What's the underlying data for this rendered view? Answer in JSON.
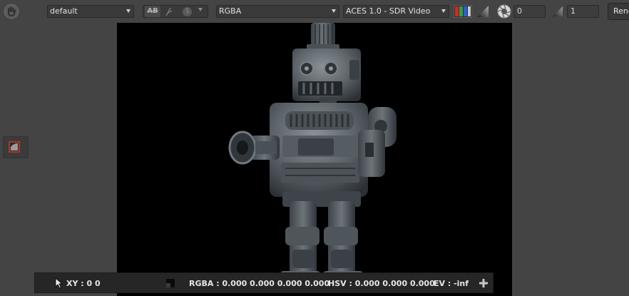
{
  "toolbar": {
    "display_preset": "default",
    "ab_label": "AB",
    "ab_index": "1",
    "channel": "RGBA",
    "colorspace": "ACES 1.0 - SDR Video",
    "gain_value": "0",
    "gamma_value": "1",
    "render_label": "Render"
  },
  "statusbar": {
    "xy": "XY : 0 0",
    "rgba": "RGBA : 0.000 0.000 0.000 0.000",
    "hsv": "HSV : 0.000 0.000 0.000",
    "ev": "EV : -inf"
  },
  "colors": {
    "background": "#444444",
    "viewer": "#000000",
    "statusbar": "#262626",
    "swatch_red": "#d9261c",
    "swatch_green": "#2ea043",
    "swatch_blue": "#2a5fd8"
  },
  "icons": [
    "hand-icon",
    "channel-swatch-icon",
    "gradient-icon",
    "aperture-icon",
    "gamma-icon",
    "crop-region-icon",
    "cursor-icon",
    "pixel-swatch-icon",
    "plus-icon"
  ]
}
